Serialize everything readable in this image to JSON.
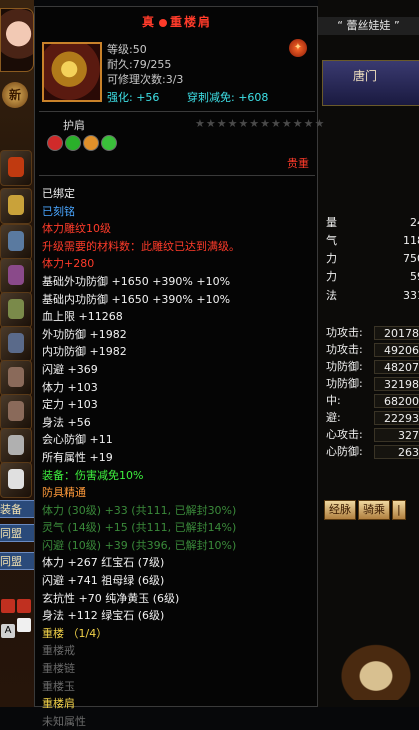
{
  "left_bar": {
    "level_badge": "新",
    "labels": [
      "装备",
      "同盟",
      "同盟"
    ],
    "mini_icon_letter": "A"
  },
  "right_panel": {
    "title": "“ 蕾丝娃娃 ”",
    "door_label": "唐门",
    "short_rows": [
      {
        "k": "量",
        "v": "24"
      },
      {
        "k": "气",
        "v": "118"
      },
      {
        "k": "力",
        "v": "750"
      },
      {
        "k": "力",
        "v": "59"
      },
      {
        "k": "法",
        "v": "331"
      }
    ],
    "rows": [
      {
        "k": "功攻击:",
        "v": "20178"
      },
      {
        "k": "功攻击:",
        "v": "49206"
      },
      {
        "k": "功防御:",
        "v": "48207"
      },
      {
        "k": "功防御:",
        "v": "32198"
      },
      {
        "k": "中:",
        "v": "68200"
      },
      {
        "k": "避:",
        "v": "22293"
      },
      {
        "k": "心攻击:",
        "v": "327"
      },
      {
        "k": "心防御:",
        "v": "263"
      }
    ],
    "tabs": [
      "经脉",
      "骑乘",
      "|"
    ]
  },
  "tooltip": {
    "title_left": "真",
    "title_right": "重楼肩",
    "stats": {
      "level": "等级:50",
      "durability": "耐久:79/255",
      "repairs": "可修理次数:3/3",
      "enhance": "强化: +56",
      "pierce": "穿刺减免: +608"
    },
    "slot_label": "护肩",
    "stars": "★★★★★★★★★★★★",
    "value_tag": "贵重",
    "lines": [
      {
        "text": "已绑定",
        "color": "white"
      },
      {
        "text": "已刻铭",
        "color": "blue"
      },
      {
        "text": "体力雕纹10级",
        "color": "red"
      },
      {
        "text": "升级需要的材料数：此雕纹已达到满级。",
        "color": "red"
      },
      {
        "text": "体力+280",
        "color": "red"
      },
      {
        "text": "基础外功防御 +1650 +390% +10%",
        "color": "white"
      },
      {
        "text": "基础内功防御 +1650 +390% +10%",
        "color": "white"
      },
      {
        "text": "血上限 +11268",
        "color": "white"
      },
      {
        "text": "外功防御 +1982",
        "color": "white"
      },
      {
        "text": "内功防御 +1982",
        "color": "white"
      },
      {
        "text": "闪避 +369",
        "color": "white"
      },
      {
        "text": "体力 +103",
        "color": "white"
      },
      {
        "text": "定力 +103",
        "color": "white"
      },
      {
        "text": "身法 +56",
        "color": "white"
      },
      {
        "text": "会心防御 +11",
        "color": "white"
      },
      {
        "text": "所有属性 +19",
        "color": "white"
      },
      {
        "text": "装备：伤害减免10%",
        "color": "green"
      },
      {
        "text": "防具精通",
        "color": "orange"
      },
      {
        "text": "体力 (30级) +33 (共111, 已解封30%)",
        "color": "dimgreen"
      },
      {
        "text": "灵气 (14级) +15 (共111, 已解封14%)",
        "color": "dimgreen"
      },
      {
        "text": "闪避 (10级) +39 (共396, 已解封10%)",
        "color": "dimgreen"
      },
      {
        "text": "体力 +267 红宝石 (7级)",
        "color": "white"
      },
      {
        "text": "闪避 +741 祖母绿 (6级)",
        "color": "white"
      },
      {
        "text": "玄抗性 +70 纯净黄玉 (6级)",
        "color": "white"
      },
      {
        "text": "身法 +112 绿宝石 (6级)",
        "color": "white"
      },
      {
        "text": "重楼 （1/4）",
        "color": "gold"
      },
      {
        "text": "重楼戒",
        "color": "gray"
      },
      {
        "text": "重楼链",
        "color": "gray"
      },
      {
        "text": "重楼玉",
        "color": "gray"
      },
      {
        "text": "重楼肩",
        "color": "gold"
      },
      {
        "text": "未知属性",
        "color": "gray"
      }
    ]
  },
  "colors": {
    "title": "#ff3b2a",
    "white": "#f2f2f2",
    "blue": "#4aa6ff",
    "red": "#ff3b2a",
    "green": "#3ef03e",
    "cyan": "#3ee0e6",
    "orange": "#ff9a3a",
    "dimgreen": "#3a8a3a",
    "gray": "#6a6a6a",
    "gold": "#f2d24a"
  }
}
